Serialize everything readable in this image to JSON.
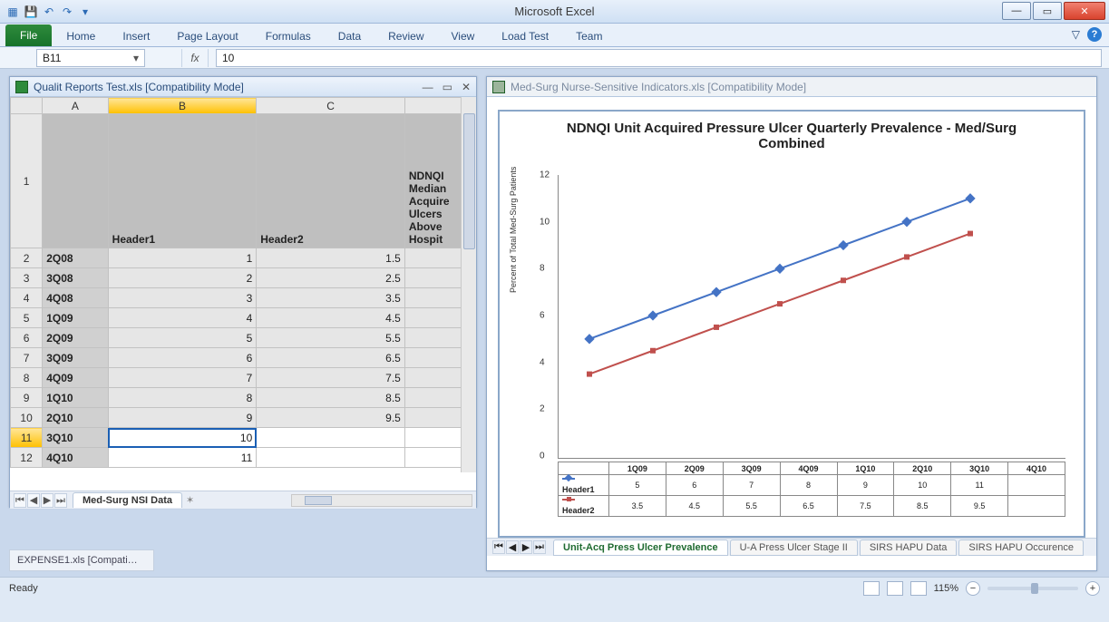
{
  "app": {
    "title": "Microsoft Excel"
  },
  "qat": {
    "save": "💾",
    "undo": "↶",
    "redo": "↷"
  },
  "ribbon": {
    "file": "File",
    "tabs": [
      "Home",
      "Insert",
      "Page Layout",
      "Formulas",
      "Data",
      "Review",
      "View",
      "Load Test",
      "Team"
    ]
  },
  "namebox": "B11",
  "fx_label": "fx",
  "formula": "10",
  "left_wb": {
    "title": "Qualit Reports Test.xls  [Compatibility Mode]",
    "columns": [
      "A",
      "B",
      "C"
    ],
    "header_row": {
      "A": "",
      "B": "Header1",
      "C": "Header2",
      "D": "NDNQI Median Acquire Ulcers Above Hospit"
    },
    "rows": [
      {
        "n": 2,
        "A": "2Q08",
        "B": "1",
        "C": "1.5"
      },
      {
        "n": 3,
        "A": "3Q08",
        "B": "2",
        "C": "2.5"
      },
      {
        "n": 4,
        "A": "4Q08",
        "B": "3",
        "C": "3.5"
      },
      {
        "n": 5,
        "A": "1Q09",
        "B": "4",
        "C": "4.5"
      },
      {
        "n": 6,
        "A": "2Q09",
        "B": "5",
        "C": "5.5"
      },
      {
        "n": 7,
        "A": "3Q09",
        "B": "6",
        "C": "6.5"
      },
      {
        "n": 8,
        "A": "4Q09",
        "B": "7",
        "C": "7.5"
      },
      {
        "n": 9,
        "A": "1Q10",
        "B": "8",
        "C": "8.5"
      },
      {
        "n": 10,
        "A": "2Q10",
        "B": "9",
        "C": "9.5"
      },
      {
        "n": 11,
        "A": "3Q10",
        "B": "10",
        "C": ""
      },
      {
        "n": 12,
        "A": "4Q10",
        "B": "11",
        "C": ""
      }
    ],
    "sheet_tab": "Med-Surg NSI Data"
  },
  "right_wb": {
    "title": "Med-Surg Nurse-Sensitive Indicators.xls  [Compatibility Mode]",
    "tabs": [
      "Unit-Acq Press Ulcer Prevalence",
      "U-A Press Ulcer Stage II",
      "SIRS HAPU Data",
      "SIRS HAPU Occurence"
    ]
  },
  "chart_data": {
    "type": "line",
    "title": "NDNQI Unit Acquired Pressure Ulcer Quarterly Prevalence - Med/Surg Combined",
    "ylabel": "Percent of Total Med-Surg Patients",
    "ylim": [
      0,
      12
    ],
    "yticks": [
      0,
      2,
      4,
      6,
      8,
      10,
      12
    ],
    "categories": [
      "1Q09",
      "2Q09",
      "3Q09",
      "4Q09",
      "1Q10",
      "2Q10",
      "3Q10",
      "4Q10"
    ],
    "series": [
      {
        "name": "Header1",
        "color": "#4473c5",
        "marker": "diamond",
        "values": [
          5,
          6,
          7,
          8,
          9,
          10,
          11,
          null
        ]
      },
      {
        "name": "Header2",
        "color": "#c0504d",
        "marker": "square",
        "values": [
          3.5,
          4.5,
          5.5,
          6.5,
          7.5,
          8.5,
          9.5,
          null
        ]
      }
    ]
  },
  "task_tab": "EXPENSE1.xls  [Compati…",
  "status": {
    "ready": "Ready",
    "zoom": "115%"
  }
}
